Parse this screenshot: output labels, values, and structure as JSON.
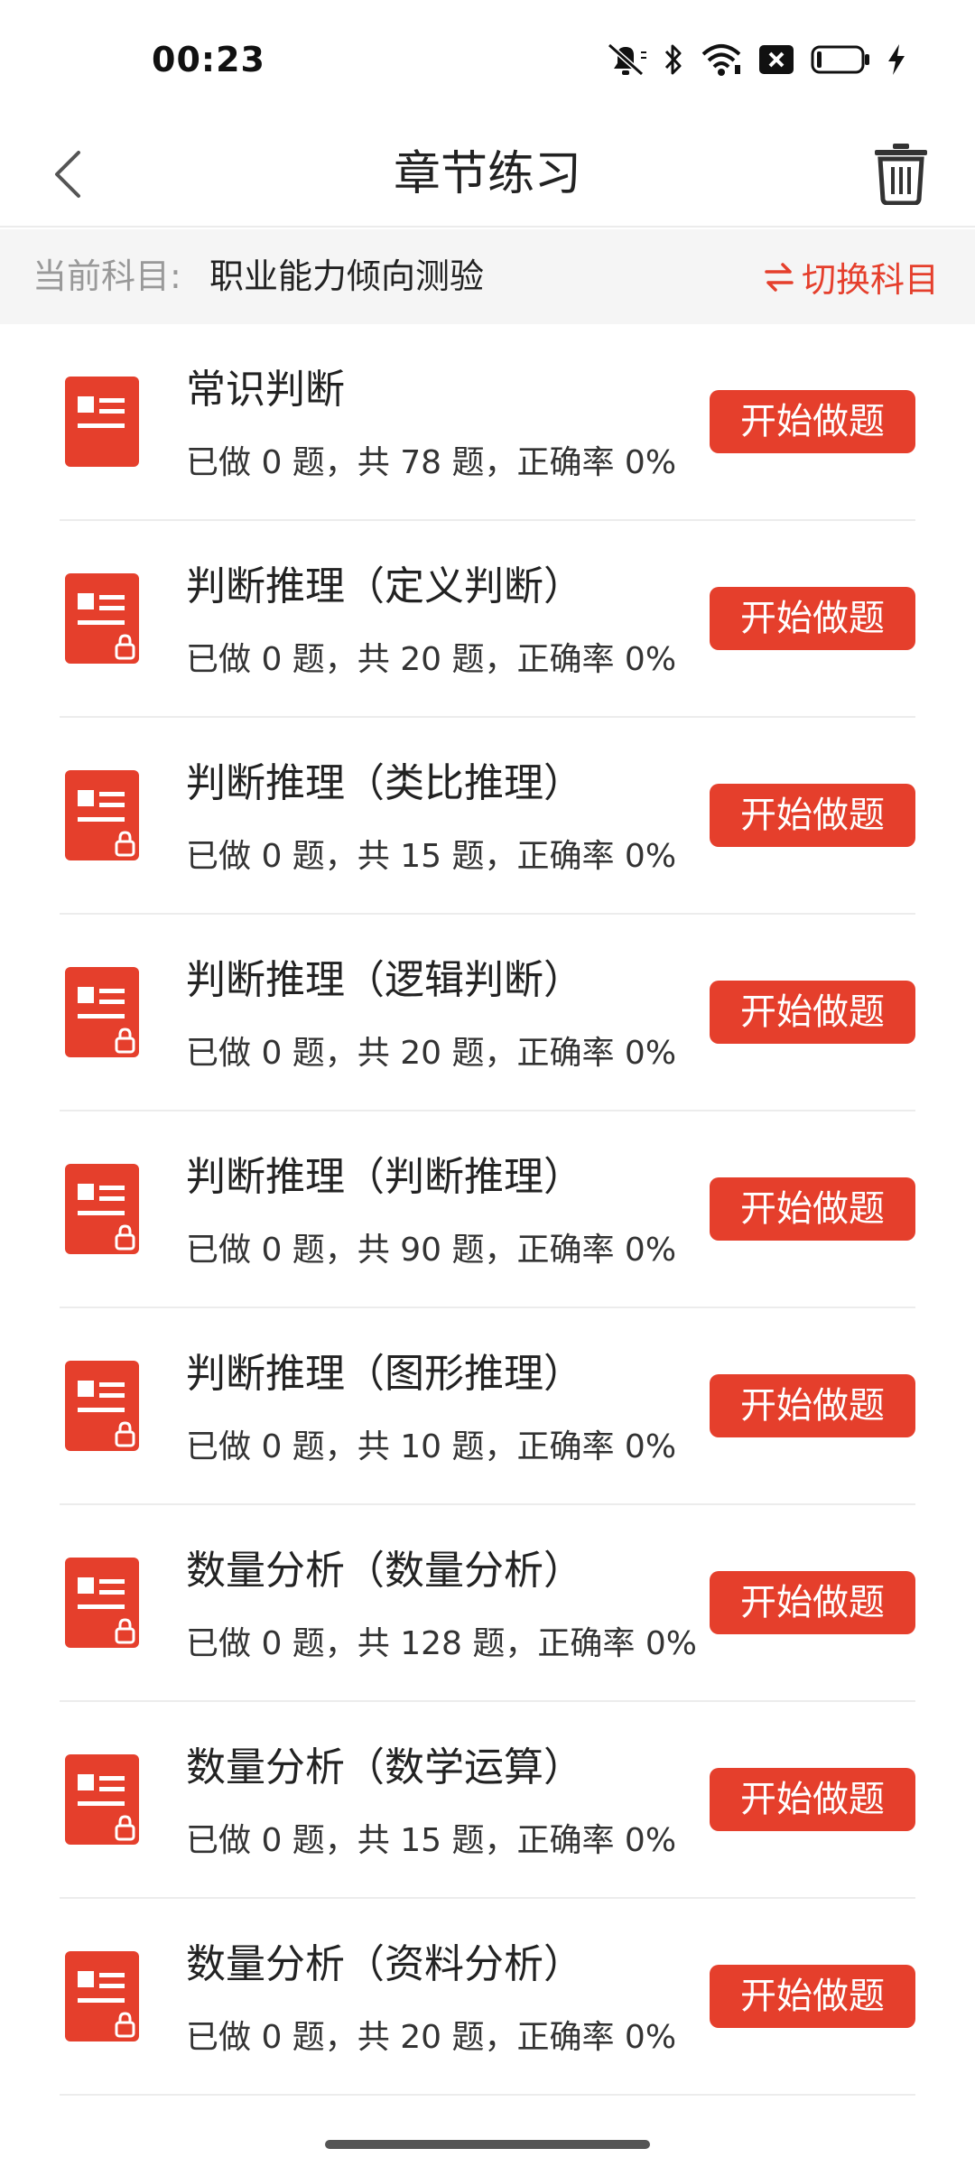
{
  "status_bar": {
    "time": "00:23",
    "icons": [
      "bell-off-icon",
      "bluetooth-icon",
      "wifi-icon",
      "sim-error-icon",
      "battery-icon",
      "charging-icon"
    ]
  },
  "header": {
    "title": "章节练习",
    "back_icon": "chevron-left-icon",
    "trash_icon": "trash-icon"
  },
  "subject": {
    "label": "当前科目:",
    "name": "职业能力倾向测验",
    "switch_label": "切换科目",
    "switch_icon": "swap-arrows-icon"
  },
  "colors": {
    "accent": "#e53f2c",
    "divider": "#ececec",
    "subject_bg": "#f5f5f5"
  },
  "chapters": [
    {
      "title": "常识判断",
      "stats": "已做 0 题，共 78 题，正确率 0%",
      "button": "开始做题",
      "locked": false
    },
    {
      "title": "判断推理（定义判断）",
      "stats": "已做 0 题，共 20 题，正确率 0%",
      "button": "开始做题",
      "locked": true
    },
    {
      "title": "判断推理（类比推理）",
      "stats": "已做 0 题，共 15 题，正确率 0%",
      "button": "开始做题",
      "locked": true
    },
    {
      "title": "判断推理（逻辑判断）",
      "stats": "已做 0 题，共 20 题，正确率 0%",
      "button": "开始做题",
      "locked": true
    },
    {
      "title": "判断推理（判断推理）",
      "stats": "已做 0 题，共 90 题，正确率 0%",
      "button": "开始做题",
      "locked": true
    },
    {
      "title": "判断推理（图形推理）",
      "stats": "已做 0 题，共 10 题，正确率 0%",
      "button": "开始做题",
      "locked": true
    },
    {
      "title": "数量分析（数量分析）",
      "stats": "已做 0 题，共 128 题，正确率 0%",
      "button": "开始做题",
      "locked": true
    },
    {
      "title": "数量分析（数学运算）",
      "stats": "已做 0 题，共 15 题，正确率 0%",
      "button": "开始做题",
      "locked": true
    },
    {
      "title": "数量分析（资料分析）",
      "stats": "已做 0 题，共 20 题，正确率 0%",
      "button": "开始做题",
      "locked": true
    }
  ]
}
